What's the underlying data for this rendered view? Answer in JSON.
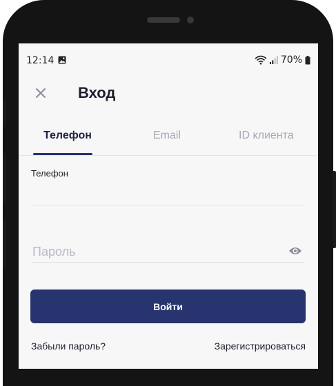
{
  "status_bar": {
    "time": "12:14",
    "battery": "70%",
    "icons": [
      "image-icon",
      "wifi-icon",
      "signal-icon",
      "battery-icon"
    ]
  },
  "header": {
    "title": "Вход",
    "close_icon": "close-icon"
  },
  "tabs": [
    {
      "label": "Телефон",
      "active": true
    },
    {
      "label": "Email",
      "active": false
    },
    {
      "label": "ID клиента",
      "active": false
    }
  ],
  "form": {
    "phone_label": "Телефон",
    "phone_value": "",
    "password_placeholder": "Пароль",
    "password_value": "",
    "show_password_icon": "eye-icon",
    "submit_label": "Войти"
  },
  "links": {
    "forgot_password": "Забыли пароль?",
    "register": "Зарегистрироваться"
  },
  "colors": {
    "primary": "#27346f",
    "background": "#f7f7f8",
    "text": "#1e1f2e",
    "muted": "#a6a9b4"
  }
}
